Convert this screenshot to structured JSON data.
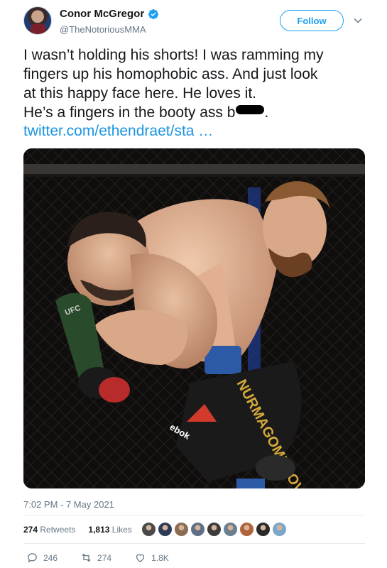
{
  "author": {
    "display_name": "Conor McGregor",
    "handle": "@TheNotoriousMMA",
    "avatar_icon": "avatar-photo",
    "verified_icon": "verified-badge-icon",
    "verified_color": "#1da1f2"
  },
  "header": {
    "follow_label": "Follow",
    "menu_icon": "chevron-down-icon"
  },
  "tweet": {
    "lines": [
      "I wasn’t holding his shorts! I was ramming my",
      "fingers up his homophobic ass. And just look",
      "at this happy face here. He loves it.",
      "He’s a fingers in the booty ass b"
    ],
    "line4_suffix": ".",
    "link": "twitter.com/ethendraet/sta …",
    "link_color": "#1b95e0"
  },
  "photo": {
    "shorts_text": "NURMAGOMEDOV",
    "logo_text": "UFC",
    "sponsor_text": "ebok"
  },
  "meta": {
    "timestamp": "7:02 PM - 7 May 2021",
    "retweets_count": "274",
    "retweets_label": "Retweets",
    "likes_count": "1,813",
    "likes_label": "Likes"
  },
  "liker_avatars": [
    {
      "name": "liker-avatar-1",
      "color": "#4a4a4a"
    },
    {
      "name": "liker-avatar-2",
      "color": "#2b3a55"
    },
    {
      "name": "liker-avatar-3",
      "color": "#8a6d52"
    },
    {
      "name": "liker-avatar-4",
      "color": "#5f6f86"
    },
    {
      "name": "liker-avatar-5",
      "color": "#3c3c3c"
    },
    {
      "name": "liker-avatar-6",
      "color": "#6b7f8f"
    },
    {
      "name": "liker-avatar-7",
      "color": "#b0643c"
    },
    {
      "name": "liker-avatar-8",
      "color": "#2a2a2a"
    },
    {
      "name": "liker-avatar-9",
      "color": "#7da7c9"
    }
  ],
  "actions": {
    "reply_count": "246",
    "retweet_count": "274",
    "like_count": "1.8K",
    "reply_icon": "reply-icon",
    "retweet_icon": "retweet-icon",
    "like_icon": "heart-icon"
  },
  "colors": {
    "accent": "#1da1f2",
    "secondary_text": "#657786"
  }
}
